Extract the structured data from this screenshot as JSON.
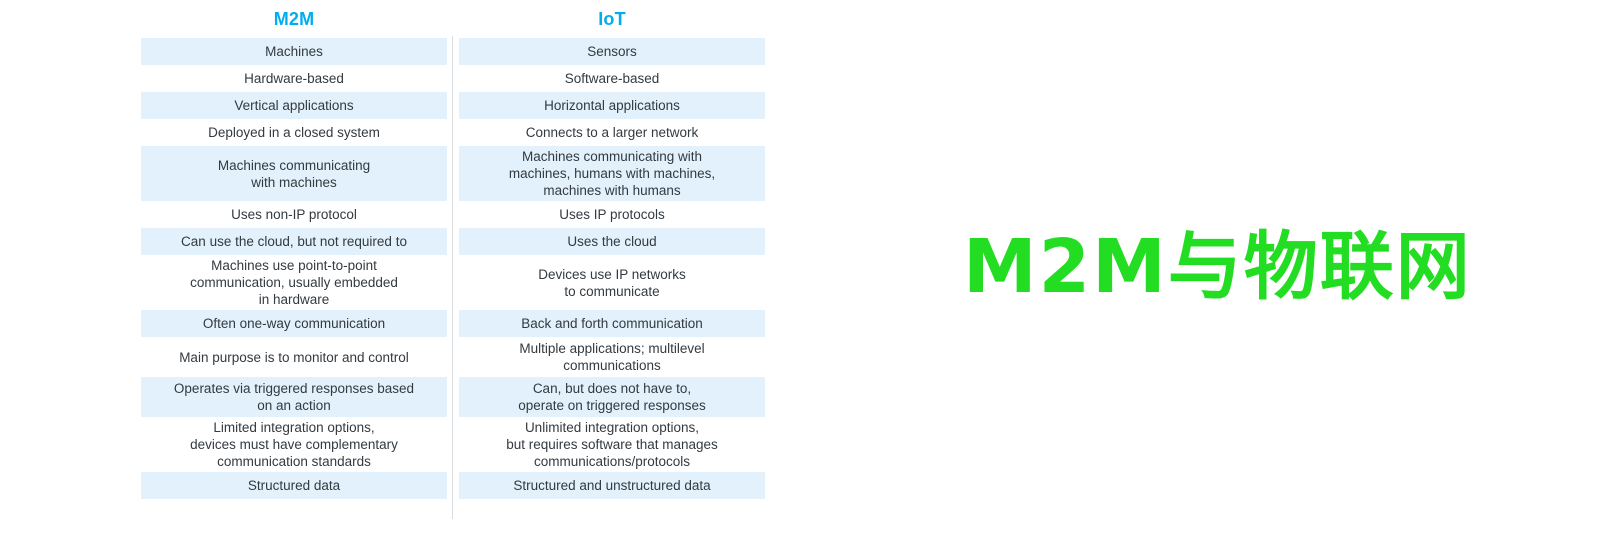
{
  "overlay": {
    "title": "M2M与物联网",
    "color": "#22DD22"
  },
  "table": {
    "header_color": "#00ADEF",
    "shaded_row_color": "#e2f1fb",
    "text_color": "#333a40",
    "columns": [
      {
        "id": "m2m",
        "label": "M2M"
      },
      {
        "id": "iot",
        "label": "IoT"
      }
    ],
    "rows": [
      {
        "shaded": true,
        "height": "rh1",
        "m2m": "Machines",
        "iot": "Sensors"
      },
      {
        "shaded": false,
        "height": "rh1",
        "m2m": "Hardware-based",
        "iot": "Software-based"
      },
      {
        "shaded": true,
        "height": "rh1",
        "m2m": "Vertical applications",
        "iot": "Horizontal applications"
      },
      {
        "shaded": false,
        "height": "rh1",
        "m2m": "Deployed in a closed system",
        "iot": "Connects to a larger network"
      },
      {
        "shaded": true,
        "height": "rh3",
        "m2m": "Machines communicating\nwith machines",
        "iot": "Machines communicating with\nmachines, humans with machines,\nmachines with humans"
      },
      {
        "shaded": false,
        "height": "rh1",
        "m2m": "Uses non-IP protocol",
        "iot": "Uses IP protocols"
      },
      {
        "shaded": true,
        "height": "rh1",
        "m2m": "Can use the cloud, but not required to",
        "iot": "Uses the cloud"
      },
      {
        "shaded": false,
        "height": "rh3",
        "m2m": "Machines use point-to-point\ncommunication, usually embedded\nin hardware",
        "iot": "Devices use IP networks\nto communicate"
      },
      {
        "shaded": true,
        "height": "rh1",
        "m2m": "Often one-way communication",
        "iot": "Back and forth communication"
      },
      {
        "shaded": false,
        "height": "rh2",
        "m2m": "Main purpose is to monitor and control",
        "iot": "Multiple applications; multilevel\ncommunications"
      },
      {
        "shaded": true,
        "height": "rh2",
        "m2m": "Operates via triggered responses based\non an action",
        "iot": "Can, but does not have to,\noperate on triggered responses"
      },
      {
        "shaded": false,
        "height": "rh3",
        "m2m": "Limited integration options,\ndevices must have complementary\ncommunication standards",
        "iot": "Unlimited integration options,\nbut requires software that manages\ncommunications/protocols"
      },
      {
        "shaded": true,
        "height": "rh1",
        "m2m": "Structured data",
        "iot": "Structured and unstructured data"
      }
    ]
  }
}
